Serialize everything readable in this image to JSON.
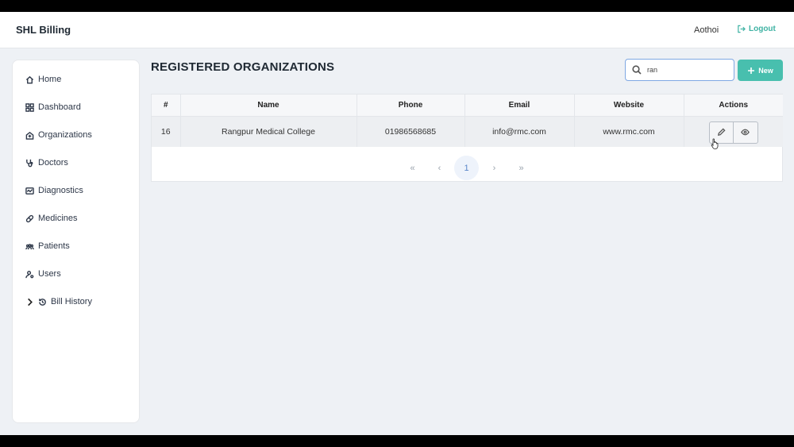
{
  "app": {
    "brand": "SHL Billing"
  },
  "header": {
    "username": "Aothoi",
    "logout_label": "Logout"
  },
  "sidebar": {
    "items": [
      {
        "label": "Home",
        "icon": "home-icon"
      },
      {
        "label": "Dashboard",
        "icon": "dashboard-icon"
      },
      {
        "label": "Organizations",
        "icon": "hospital-icon"
      },
      {
        "label": "Doctors",
        "icon": "stethoscope-icon"
      },
      {
        "label": "Diagnostics",
        "icon": "diagnostics-icon"
      },
      {
        "label": "Medicines",
        "icon": "pill-icon"
      },
      {
        "label": "Patients",
        "icon": "people-icon"
      },
      {
        "label": "Users",
        "icon": "user-gear-icon"
      },
      {
        "label": "Bill History",
        "icon": "history-icon"
      }
    ]
  },
  "main": {
    "title": "REGISTERED ORGANIZATIONS",
    "search": {
      "value": "ran",
      "placeholder": ""
    },
    "new_label": "New",
    "table": {
      "columns": [
        "#",
        "Name",
        "Phone",
        "Email",
        "Website",
        "Actions"
      ],
      "rows": [
        {
          "id": "16",
          "name": "Rangpur Medical College",
          "phone": "01986568685",
          "email": "info@rmc.com",
          "website": "www.rmc.com"
        }
      ]
    },
    "pagination": {
      "first": "«",
      "prev": "‹",
      "current": "1",
      "next": "›",
      "last": "»"
    }
  },
  "colors": {
    "accent": "#48bfae",
    "logout": "#3eb2a3",
    "search_border": "#7fa8e3"
  }
}
